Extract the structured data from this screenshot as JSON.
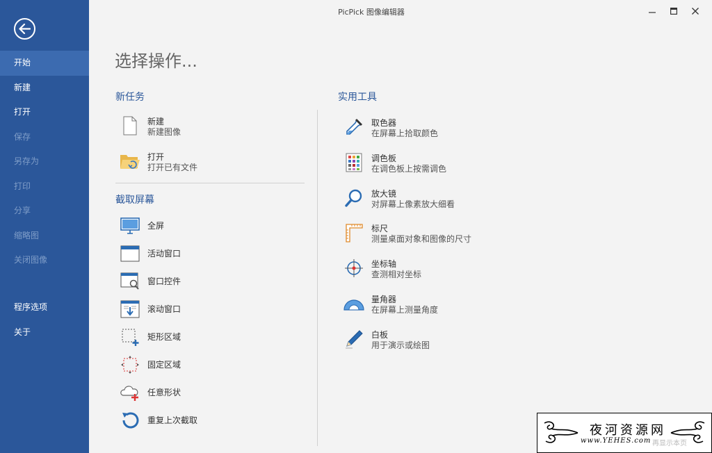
{
  "window": {
    "title": "PicPick 图像编辑器"
  },
  "sidebar": {
    "items": [
      {
        "label": "开始",
        "state": "active"
      },
      {
        "label": "新建",
        "state": "enabled"
      },
      {
        "label": "打开",
        "state": "enabled"
      },
      {
        "label": "保存",
        "state": "disabled"
      },
      {
        "label": "另存为",
        "state": "disabled"
      },
      {
        "label": "打印",
        "state": "disabled"
      },
      {
        "label": "分享",
        "state": "disabled"
      },
      {
        "label": "缩略图",
        "state": "disabled"
      },
      {
        "label": "关闭图像",
        "state": "disabled"
      }
    ],
    "bottom_items": [
      {
        "label": "程序选项"
      },
      {
        "label": "关于"
      }
    ]
  },
  "main": {
    "heading": "选择操作...",
    "new_task": {
      "title": "新任务",
      "items": [
        {
          "name": "新建",
          "desc": "新建图像",
          "icon": "blank-file-icon"
        },
        {
          "name": "打开",
          "desc": "打开已有文件",
          "icon": "folder-open-icon"
        }
      ]
    },
    "capture": {
      "title": "截取屏幕",
      "items": [
        {
          "name": "全屏",
          "icon": "monitor-icon"
        },
        {
          "name": "活动窗口",
          "icon": "window-icon"
        },
        {
          "name": "窗口控件",
          "icon": "window-control-icon"
        },
        {
          "name": "滚动窗口",
          "icon": "scroll-window-icon"
        },
        {
          "name": "矩形区域",
          "icon": "rectangle-region-icon"
        },
        {
          "name": "固定区域",
          "icon": "fixed-region-icon"
        },
        {
          "name": "任意形状",
          "icon": "freehand-shape-icon"
        },
        {
          "name": "重复上次截取",
          "icon": "repeat-capture-icon"
        }
      ]
    },
    "tools": {
      "title": "实用工具",
      "items": [
        {
          "name": "取色器",
          "desc": "在屏幕上拾取颜色",
          "icon": "eyedropper-icon"
        },
        {
          "name": "调色板",
          "desc": "在调色板上按需调色",
          "icon": "palette-icon"
        },
        {
          "name": "放大镜",
          "desc": "对屏幕上像素放大细看",
          "icon": "magnifier-icon"
        },
        {
          "name": "标尺",
          "desc": "测量桌面对象和图像的尺寸",
          "icon": "ruler-icon"
        },
        {
          "name": "坐标轴",
          "desc": "查测相对坐标",
          "icon": "crosshair-icon"
        },
        {
          "name": "量角器",
          "desc": "在屏幕上测量角度",
          "icon": "protractor-icon"
        },
        {
          "name": "白板",
          "desc": "用于演示或绘图",
          "icon": "pen-icon"
        }
      ]
    }
  },
  "watermark": {
    "title": "夜河资源网",
    "url": "www.YEHES.com",
    "faint_text": "再显示本页"
  },
  "colors": {
    "sidebar": "#2b579a",
    "sidebar_active": "#3c6bb0",
    "accent": "#2b579a"
  }
}
